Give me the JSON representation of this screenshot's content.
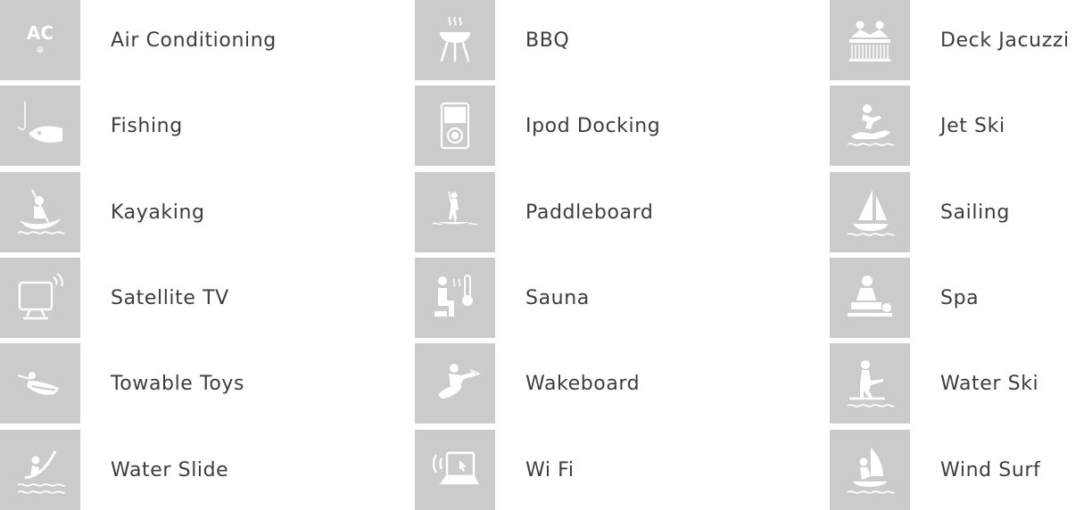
{
  "amenities": [
    {
      "label": "Air Conditioning",
      "icon": "air-conditioning-icon"
    },
    {
      "label": "BBQ",
      "icon": "bbq-icon"
    },
    {
      "label": "Deck Jacuzzi",
      "icon": "deck-jacuzzi-icon"
    },
    {
      "label": "Fishing",
      "icon": "fishing-icon"
    },
    {
      "label": "Ipod Docking",
      "icon": "ipod-docking-icon"
    },
    {
      "label": "Jet Ski",
      "icon": "jet-ski-icon"
    },
    {
      "label": "Kayaking",
      "icon": "kayaking-icon"
    },
    {
      "label": "Paddleboard",
      "icon": "paddleboard-icon"
    },
    {
      "label": "Sailing",
      "icon": "sailing-icon"
    },
    {
      "label": "Satellite TV",
      "icon": "satellite-tv-icon"
    },
    {
      "label": "Sauna",
      "icon": "sauna-icon"
    },
    {
      "label": "Spa",
      "icon": "spa-icon"
    },
    {
      "label": "Towable Toys",
      "icon": "towable-toys-icon"
    },
    {
      "label": "Wakeboard",
      "icon": "wakeboard-icon"
    },
    {
      "label": "Water Ski",
      "icon": "water-ski-icon"
    },
    {
      "label": "Water Slide",
      "icon": "water-slide-icon"
    },
    {
      "label": "Wi Fi",
      "icon": "wifi-icon"
    },
    {
      "label": "Wind Surf",
      "icon": "wind-surf-icon"
    }
  ],
  "icon_ac_text": "AC",
  "colors": {
    "tile_background": "#cbcbcb",
    "icon_foreground": "#ffffff",
    "label_text": "#3d3d3d"
  }
}
